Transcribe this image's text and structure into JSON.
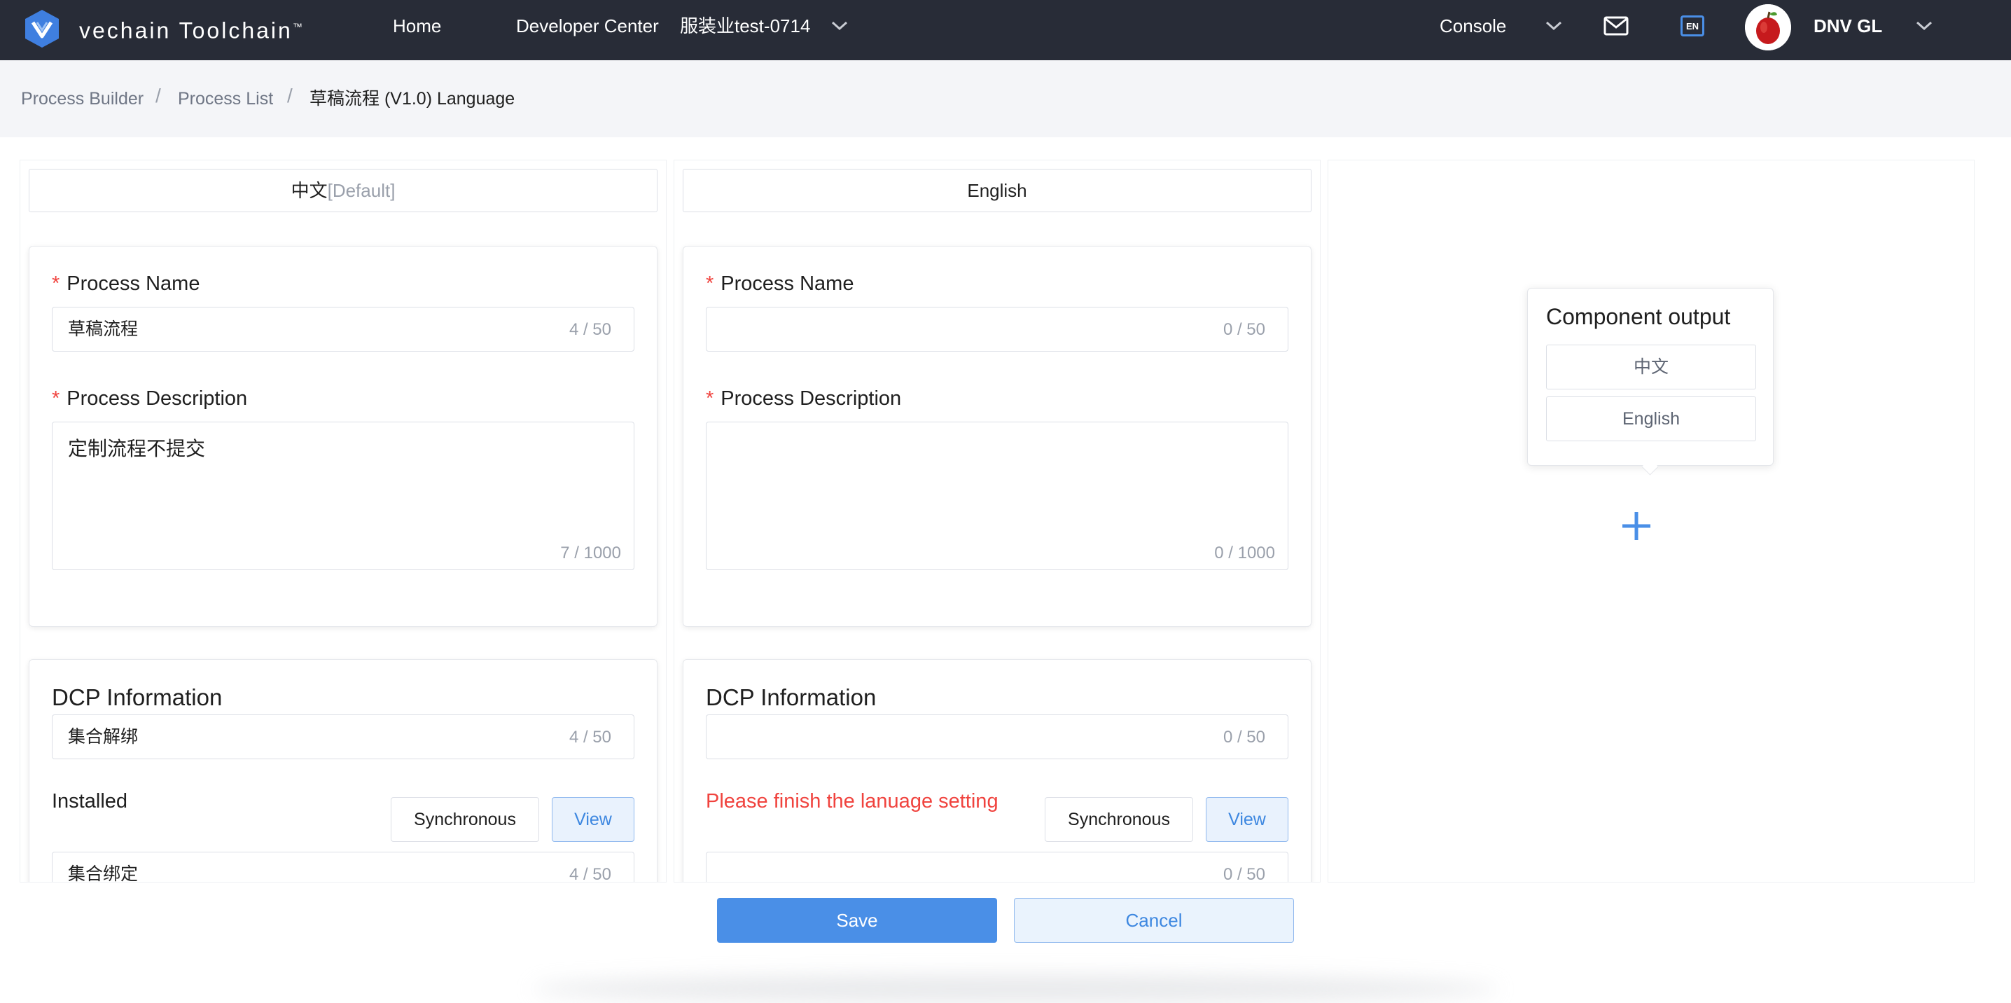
{
  "nav": {
    "brand": "vechain Toolchain",
    "brand_tm": "™",
    "home": "Home",
    "developer_center": "Developer Center",
    "workspace": "服装业test-0714",
    "console": "Console",
    "lang_badge": "EN",
    "user": "DNV GL"
  },
  "breadcrumb": {
    "items": [
      "Process Builder",
      "Process List",
      "草稿流程 (V1.0) Language"
    ],
    "separator": "/"
  },
  "columns": [
    {
      "tab_label": "中文",
      "tab_suffix": "[Default]",
      "process_name_label": "Process Name",
      "process_name_value": "草稿流程",
      "process_name_count": "4 / 50",
      "process_desc_label": "Process Description",
      "process_desc_value": "定制流程不提交",
      "process_desc_count": "7 / 1000",
      "dcp_title": "DCP Information",
      "dcp_value": "集合解绑",
      "dcp_count": "4 / 50",
      "status": "Installed",
      "sync_label": "Synchronous",
      "view_label": "View",
      "next_value": "集合绑定",
      "next_count": "4 / 50"
    },
    {
      "tab_label": "English",
      "tab_suffix": "",
      "process_name_label": "Process Name",
      "process_name_value": "",
      "process_name_count": "0 / 50",
      "process_desc_label": "Process Description",
      "process_desc_value": "",
      "process_desc_count": "0 / 1000",
      "dcp_title": "DCP Information",
      "dcp_value": "",
      "dcp_count": "0 / 50",
      "status": "Please finish the lanuage setting",
      "sync_label": "Synchronous",
      "view_label": "View",
      "next_value": "",
      "next_count": "0 / 50"
    }
  ],
  "component_output": {
    "title": "Component output",
    "options": [
      "中文",
      "English"
    ]
  },
  "footer": {
    "save": "Save",
    "cancel": "Cancel"
  },
  "colors": {
    "navbar": "#282c37",
    "accent": "#4a8fe7",
    "required": "#f0433e",
    "warning_text": "#f0433e"
  }
}
